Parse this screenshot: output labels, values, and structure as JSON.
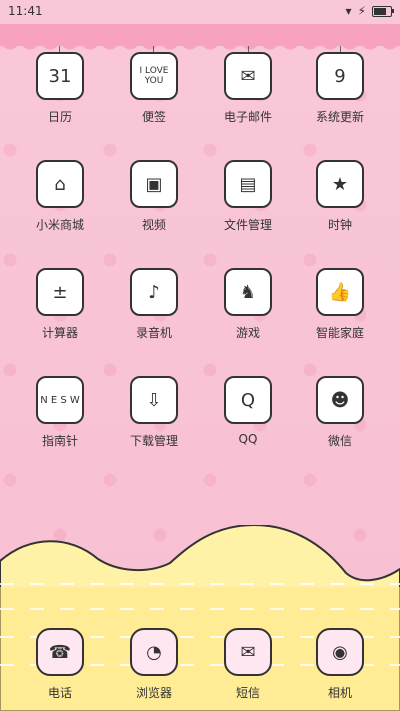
{
  "status_bar": {
    "time": "11:41",
    "icons": [
      "signal-icon",
      "charging-icon",
      "battery-icon"
    ],
    "battery_level_fraction": 0.75
  },
  "apps": {
    "row1": [
      {
        "label": "日历",
        "icon": "calendar-icon"
      },
      {
        "label": "便签",
        "icon": "notes-icon"
      },
      {
        "label": "电子邮件",
        "icon": "mail-icon"
      },
      {
        "label": "系统更新",
        "icon": "update-icon"
      }
    ],
    "row2": [
      {
        "label": "小米商城",
        "icon": "store-icon"
      },
      {
        "label": "视频",
        "icon": "tv-icon"
      },
      {
        "label": "文件管理",
        "icon": "files-icon"
      },
      {
        "label": "时钟",
        "icon": "clock-icon"
      }
    ],
    "row3": [
      {
        "label": "计算器",
        "icon": "calculator-icon"
      },
      {
        "label": "录音机",
        "icon": "recorder-icon"
      },
      {
        "label": "游戏",
        "icon": "game-icon"
      },
      {
        "label": "智能家庭",
        "icon": "smart-home-icon"
      }
    ],
    "row4": [
      {
        "label": "指南针",
        "icon": "compass-icon"
      },
      {
        "label": "下载管理",
        "icon": "download-icon"
      },
      {
        "label": "QQ",
        "icon": "qq-icon"
      },
      {
        "label": "微信",
        "icon": "wechat-icon"
      }
    ]
  },
  "dock": [
    {
      "label": "电话",
      "icon": "phone-icon"
    },
    {
      "label": "浏览器",
      "icon": "browser-icon"
    },
    {
      "label": "短信",
      "icon": "sms-icon"
    },
    {
      "label": "相机",
      "icon": "camera-icon"
    }
  ],
  "icon_glyphs": {
    "calendar_text": "31",
    "notes_text": "I LOVE YOU",
    "mail_text": "✉",
    "update_text": "9",
    "store_text": "⌂",
    "tv_text": "▣",
    "files_text": "▤",
    "clock_text": "★",
    "calculator_text": "±",
    "recorder_text": "♪",
    "game_text": "♞",
    "smart_home_text": "👍",
    "compass_text": "N E S W",
    "download_text": "⇩",
    "qq_text": "Q",
    "wechat_text": "☻",
    "phone_text": "☎",
    "browser_text": "◔",
    "sms_text": "✉",
    "camera_text": "◉"
  }
}
